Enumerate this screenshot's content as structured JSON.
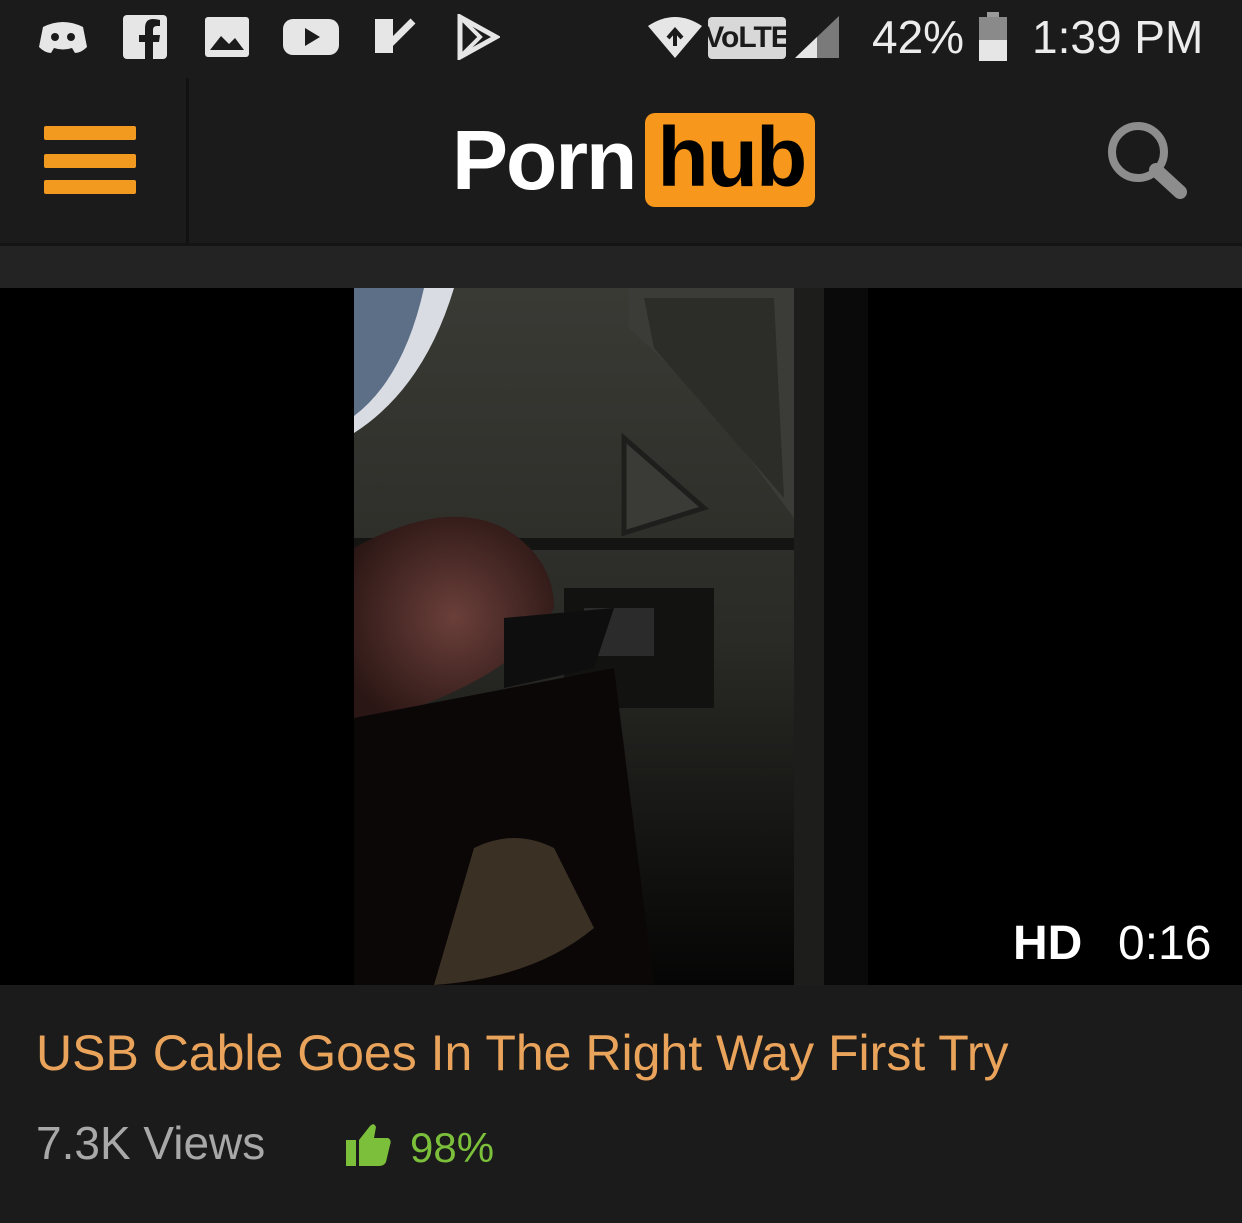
{
  "status_bar": {
    "icons": [
      "discord-icon",
      "facebook-icon",
      "gallery-icon",
      "youtube-icon",
      "feedly-icon",
      "play-store-icon",
      "wifi-icon",
      "signal-icon",
      "battery-icon"
    ],
    "volte": "VoLTE",
    "battery": "42%",
    "time": "1:39 PM"
  },
  "header": {
    "logo_left": "Porn",
    "logo_right": "hub",
    "accent_color": "#f7971b"
  },
  "video": {
    "hd_label": "HD",
    "duration": "0:16",
    "title": "USB Cable Goes In The Right Way First Try",
    "views": "7.3K Views",
    "rating": "98%"
  },
  "colors": {
    "background": "#1b1b1b",
    "title": "#e9a35a",
    "rating": "#7bbf3a"
  }
}
